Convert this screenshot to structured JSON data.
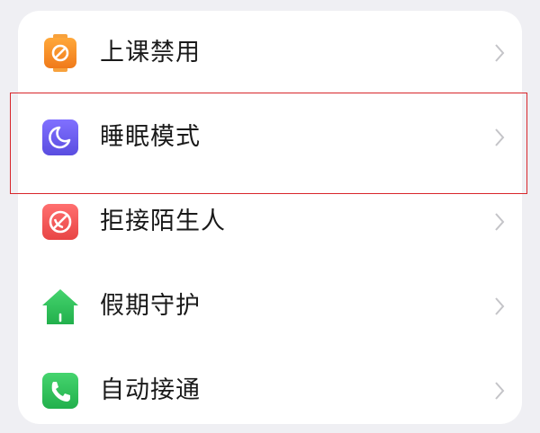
{
  "menu": {
    "items": [
      {
        "label": "上课禁用",
        "icon": "class-disable-icon",
        "color": "#f08a24"
      },
      {
        "label": "睡眠模式",
        "icon": "moon-icon",
        "color": "#6a5ff0"
      },
      {
        "label": "拒接陌生人",
        "icon": "block-call-icon",
        "color": "#ef4f4f"
      },
      {
        "label": "假期守护",
        "icon": "house-icon",
        "color": "#2fbf5a"
      },
      {
        "label": "自动接通",
        "icon": "phone-icon",
        "color": "#2fbf5a"
      }
    ],
    "chevron_icon": "chevron-right-icon"
  },
  "highlight": {
    "target": "睡眠模式",
    "color": "#d8262b"
  }
}
